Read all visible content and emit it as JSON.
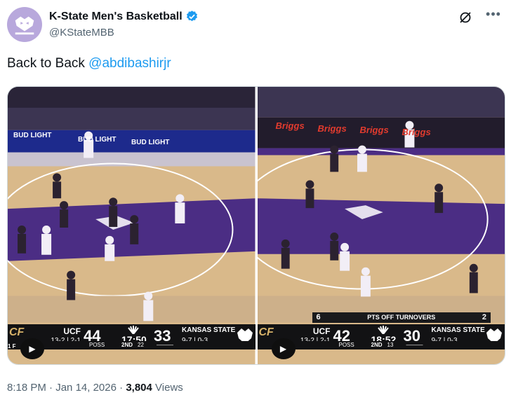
{
  "author": {
    "display_name": "K-State Men's Basketball",
    "handle": "@KStateMBB",
    "avatar_icon": "kstate-wildcat-logo",
    "verified_icon": "verified-badge-icon",
    "verified_color": "#1d9bf0"
  },
  "tweet": {
    "text_prefix": "Back to Back ",
    "mention": "@abdibashirjr",
    "link_color": "#1d9bf0"
  },
  "media": {
    "frame1": {
      "court_ads": [
        "BUD LIGHT",
        "BUD LIGHT",
        "BUD LIGHT"
      ],
      "scoreboard": {
        "away_team": "UCF",
        "away_record": "13-2 | 2-1",
        "away_score": "44",
        "clock": "17:50",
        "period": "2ND",
        "shot_clock": "22",
        "poss": "POSS",
        "home_score": "33",
        "home_team": "KANSAS STATE",
        "home_record": "9-7 | 0-3",
        "corner_text": "1 F"
      }
    },
    "frame2": {
      "court_ads": [
        "Briggs",
        "Briggs",
        "Briggs",
        "Briggs"
      ],
      "turnovers": {
        "left": "6",
        "label": "PTS OFF TURNOVERS",
        "right": "2"
      },
      "scoreboard": {
        "away_team": "UCF",
        "away_record": "13-2 | 2-1",
        "away_score": "42",
        "clock": "18:52",
        "period": "2ND",
        "shot_clock": "13",
        "poss": "POSS",
        "home_score": "30",
        "home_team": "KANSAS STATE",
        "home_record": "9-7 | 0-3"
      }
    }
  },
  "meta": {
    "time": "8:18 PM",
    "separator": "·",
    "date": "Jan 14, 2026",
    "views_count": "3,804",
    "views_label": "Views"
  },
  "colors": {
    "court_wood": "#d9b98a",
    "court_purple": "#4b2d84",
    "scoreboard_bg": "#121214"
  }
}
